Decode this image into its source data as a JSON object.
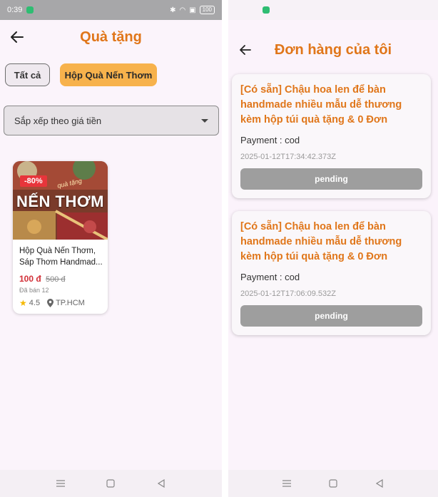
{
  "left": {
    "status": {
      "time": "0:39",
      "battery": "100"
    },
    "title": "Quà tặng",
    "chips": [
      {
        "label": "Tất cả"
      },
      {
        "label": "Hộp Quà Nến Thơm"
      }
    ],
    "sort": {
      "label": "Sắp xếp theo giá tiền"
    },
    "product": {
      "discount": "-80%",
      "image_text": "NẾN THƠM",
      "image_script": "quà tặng",
      "name_line1": "Hộp Quà Nến Thơm,",
      "name_line2": "Sáp Thơm Handmad...",
      "price": "100 đ",
      "old_price": "500 đ",
      "sold": "Đã bán 12",
      "rating": "4.5",
      "location": "TP.HCM"
    }
  },
  "right": {
    "title": "Đơn hàng của tôi",
    "orders": [
      {
        "title": "[Có sẵn] Chậu hoa len để bàn handmade nhiều mẫu dễ thương kèm hộp túi quà tặng & 0 Đơn",
        "payment": "Payment : cod",
        "date": "2025-01-12T17:34:42.373Z",
        "status": "pending"
      },
      {
        "title": "[Có sẵn] Chậu hoa len để bàn handmade nhiều mẫu dễ thương kèm hộp túi quà tặng & 0 Đơn",
        "payment": "Payment : cod",
        "date": "2025-01-12T17:06:09.532Z",
        "status": "pending"
      }
    ]
  },
  "icons": {
    "back": "arrow-left-icon",
    "dropdown": "caret-down-icon",
    "rating": "star-icon",
    "location": "map-pin-icon",
    "nav": [
      "menu-icon",
      "home-square-icon",
      "back-triangle-icon"
    ]
  },
  "colors": {
    "accent": "#e0761a",
    "chip_active": "#f7b24c",
    "discount": "#e7353b",
    "price": "#d22f37",
    "status_button": "#9e9e9e",
    "background": "#fbf4fb"
  }
}
